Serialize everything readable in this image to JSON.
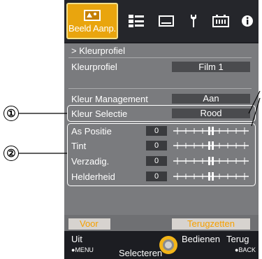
{
  "tabs": {
    "active_label": "Beeld Aanp.",
    "icons": [
      "picture-adjust-icon",
      "settings-list-icon",
      "display-icon",
      "wrench-icon",
      "battery-icon",
      "info-icon"
    ]
  },
  "section_title": "> Kleurprofiel",
  "rows": {
    "kleurprofiel": {
      "label": "Kleurprofiel",
      "value": "Film 1"
    },
    "kleur_management": {
      "label": "Kleur Management",
      "value": "Aan"
    },
    "kleur_selectie": {
      "label": "Kleur Selectie",
      "value": "Rood"
    }
  },
  "sliders": [
    {
      "label": "As Positie",
      "value": "0"
    },
    {
      "label": "Tint",
      "value": "0"
    },
    {
      "label": "Verzadig.",
      "value": "0"
    },
    {
      "label": "Helderheid",
      "value": "0"
    }
  ],
  "footer": {
    "left_button": "Voor",
    "right_button": "Terugzetten"
  },
  "help": {
    "uit": "Uit",
    "menu": "MENU",
    "selecteren": "Selecteren",
    "bedienen": "Bedienen",
    "terug": "Terug",
    "back": "BACK"
  },
  "callouts": [
    "①",
    "②"
  ],
  "colors": {
    "accent": "#e9a50e",
    "panel": "#7a7b7e",
    "dark": "#1c1d22"
  }
}
